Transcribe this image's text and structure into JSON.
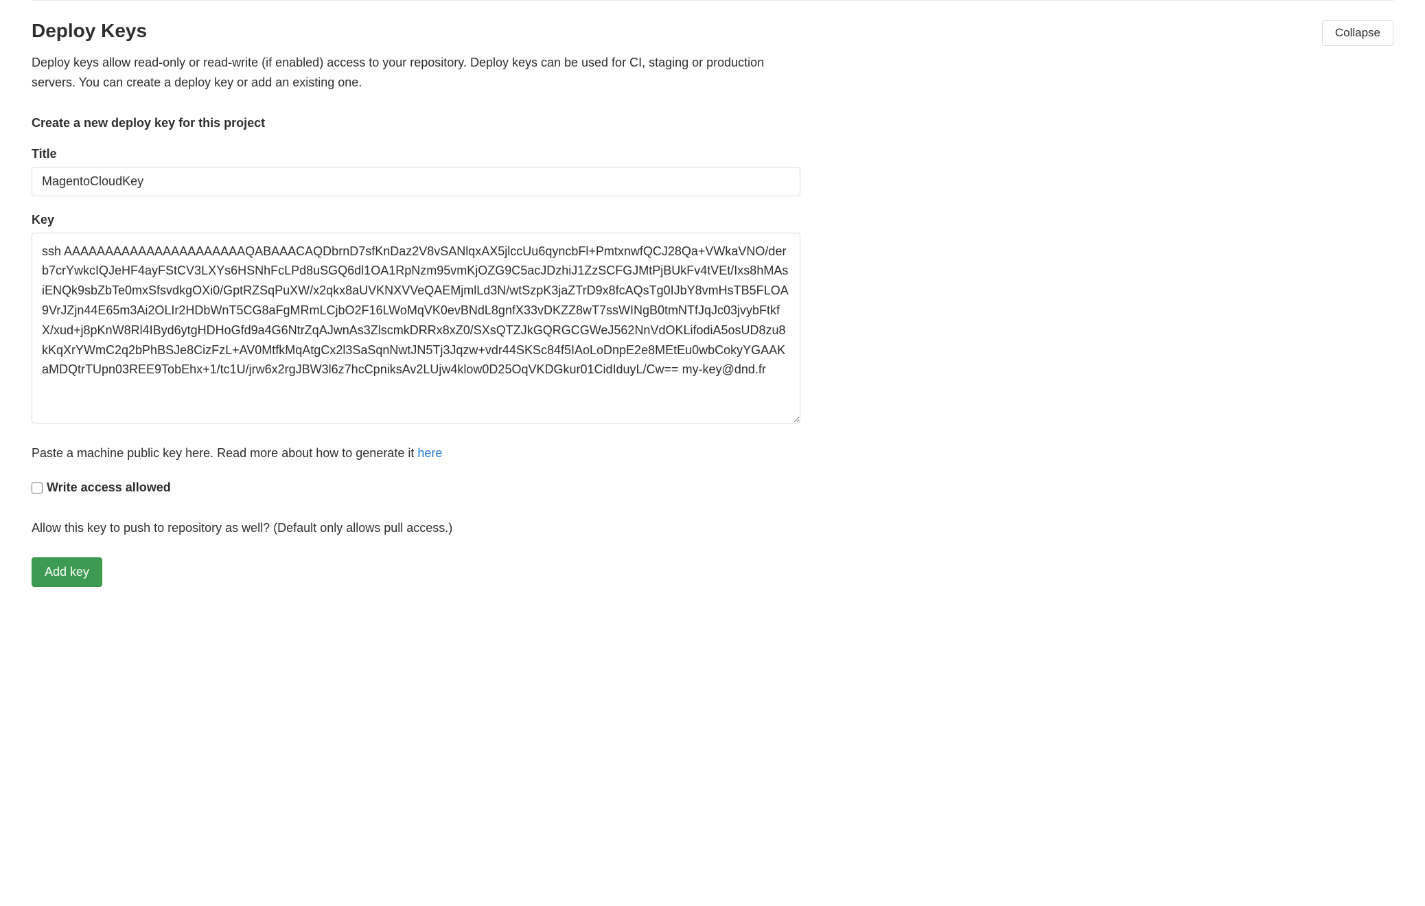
{
  "section": {
    "title": "Deploy Keys",
    "collapse_label": "Collapse",
    "description": "Deploy keys allow read-only or read-write (if enabled) access to your repository. Deploy keys can be used for CI, staging or production servers. You can create a deploy key or add an existing one."
  },
  "form": {
    "subtitle": "Create a new deploy key for this project",
    "title_label": "Title",
    "title_value": "MagentoCloudKey",
    "key_label": "Key",
    "key_value": "ssh AAAAAAAAAAAAAAAAAAAAAAQABAAACAQDbrnD7sfKnDaz2V8vSANlqxAX5jlccUu6qyncbFl+PmtxnwfQCJ28Qa+VWkaVNO/derb7crYwkcIQJeHF4ayFStCV3LXYs6HSNhFcLPd8uSGQ6dl1OA1RpNzm95vmKjOZG9C5acJDzhiJ1ZzSCFGJMtPjBUkFv4tVEt/Ixs8hMAsiENQk9sbZbTe0mxSfsvdkgOXi0/GptRZSqPuXW/x2qkx8aUVKNXVVeQAEMjmlLd3N/wtSzpK3jaZTrD9x8fcAQsTg0IJbY8vmHsTB5FLOA9VrJZjn44E65m3Ai2OLIr2HDbWnT5CG8aFgMRmLCjbO2F16LWoMqVK0evBNdL8gnfX33vDKZZ8wT7ssWINgB0tmNTfJqJc03jvybFtkfX/xud+j8pKnW8Rl4IByd6ytgHDHoGfd9a4G6NtrZqAJwnAs3ZlscmkDRRx8xZ0/SXsQTZJkGQRGCGWeJ562NnVdOKLifodiA5osUD8zu8kKqXrYWmC2q2bPhBSJe8CizFzL+AV0MtfkMqAtgCx2l3SaSqnNwtJN5Tj3Jqzw+vdr44SKSc84f5IAoLoDnpE2e8MEtEu0wbCokyYGAAKaMDQtrTUpn03REE9TobEhx+1/tc1U/jrw6x2rgJBW3l6z7hcCpniksAv2LUjw4klow0D25OqVKDGkur01CidIduyL/Cw== my-key@dnd.fr",
    "key_helper_prefix": "Paste a machine public key here. Read more about how to generate it ",
    "key_helper_link": "here",
    "write_access_label": "Write access allowed",
    "write_access_helper": "Allow this key to push to repository as well? (Default only allows pull access.)",
    "submit_label": "Add key"
  }
}
